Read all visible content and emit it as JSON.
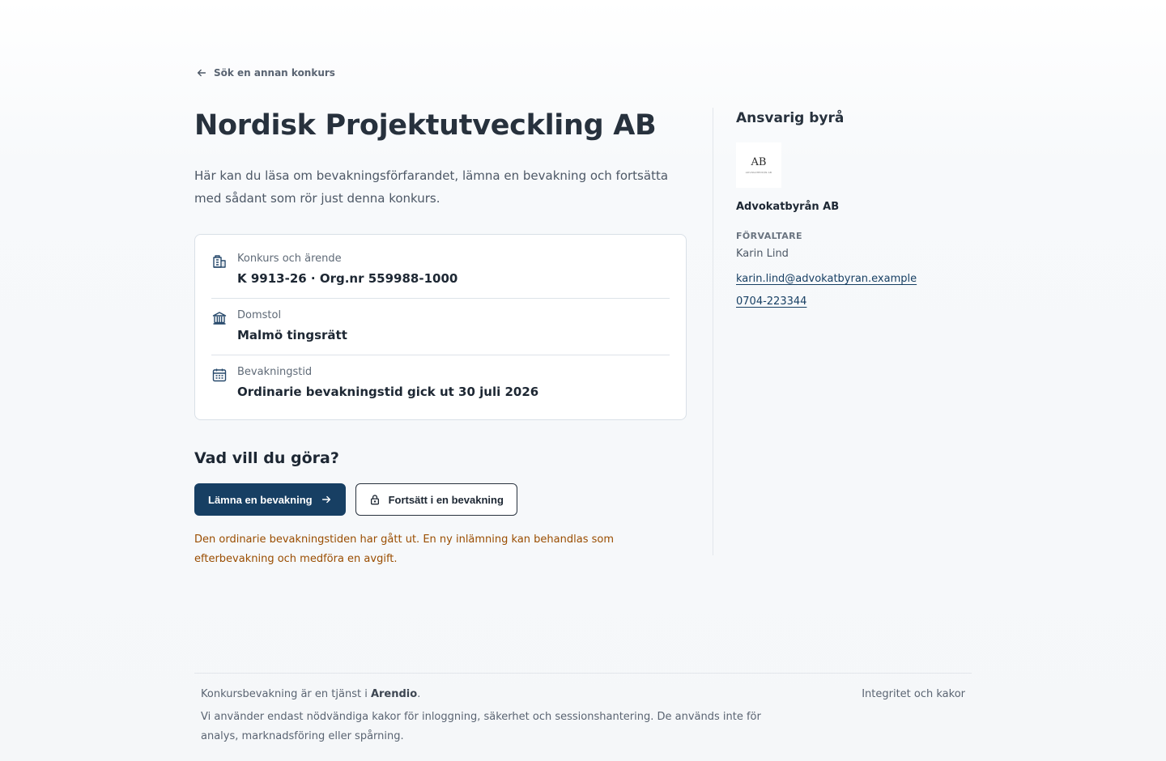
{
  "nav": {
    "back_label": "Sök en annan konkurs"
  },
  "main": {
    "title": "Nordisk Projektutveckling AB",
    "lead": "Här kan du läsa om bevakningsförfarandet, lämna en bevakning och fortsätta med sådant som rör just denna konkurs.",
    "details": [
      {
        "icon": "building-icon",
        "label": "Konkurs och ärende",
        "value": "K 9913-26 · Org.nr 559988-1000"
      },
      {
        "icon": "courthouse-icon",
        "label": "Domstol",
        "value": "Malmö tingsrätt"
      },
      {
        "icon": "calendar-icon",
        "label": "Bevakningstid",
        "value": "Ordinarie bevakningstid gick ut 30 juli 2026"
      }
    ],
    "actions_heading": "Vad vill du göra?",
    "primary_button": "Lämna en bevakning",
    "secondary_button": "Fortsätt i en bevakning",
    "warning": "Den ordinarie bevakningstiden har gått ut. En ny inlämning kan behandlas som efterbevakning och medföra en avgift."
  },
  "aside": {
    "heading": "Ansvarig byrå",
    "logo_text": "AB",
    "logo_subtext": "ADVOKATBYRÅN AB",
    "firm_name": "Advokatbyrån AB",
    "role_label": "FÖRVALTARE",
    "person_name": "Karin Lind",
    "email": "karin.lind@advokatbyran.example",
    "phone": "0704-223344"
  },
  "footer": {
    "service_prefix": "Konkursbevakning är en tjänst i ",
    "service_brand": "Arendio",
    "service_suffix": ".",
    "cookie_text": "Vi använder endast nödvändiga kakor för inloggning, säkerhet och sessionshantering. De används inte för analys, marknadsföring eller spårning.",
    "privacy_link": "Integritet och kakor"
  },
  "colors": {
    "primary": "#173f63",
    "warning": "#9a4d00",
    "text": "#1d2733"
  }
}
